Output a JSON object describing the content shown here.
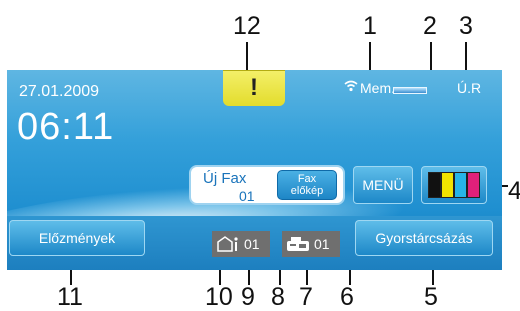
{
  "callouts": {
    "n1": "1",
    "n2": "2",
    "n3": "3",
    "n4": "4",
    "n5": "5",
    "n6": "6",
    "n7": "7",
    "n8": "8",
    "n9": "9",
    "n10": "10",
    "n11": "11",
    "n12": "12"
  },
  "screen": {
    "date": "27.01.2009",
    "time": "06:11",
    "warning_symbol": "!",
    "status": {
      "memory_label": "Mem.",
      "ur_label": "Ú.R"
    },
    "new_fax": {
      "label": "Új Fax",
      "count": "01"
    },
    "fax_preview": {
      "line1": "Fax",
      "line2": "előkép"
    },
    "menu_label": "MENÜ",
    "history_label": "Előzmények",
    "counter_left": "01",
    "counter_right": "01",
    "speed_dial_label": "Gyorstárcsázás",
    "ink_colors": [
      "#111111",
      "#f2e400",
      "#27b4e8",
      "#e0207a"
    ]
  },
  "icons": [
    "wifi-icon",
    "memory-bar-icon",
    "warning-icon",
    "ink-level-icon",
    "memory-fax-icon",
    "fax-machine-icon"
  ]
}
